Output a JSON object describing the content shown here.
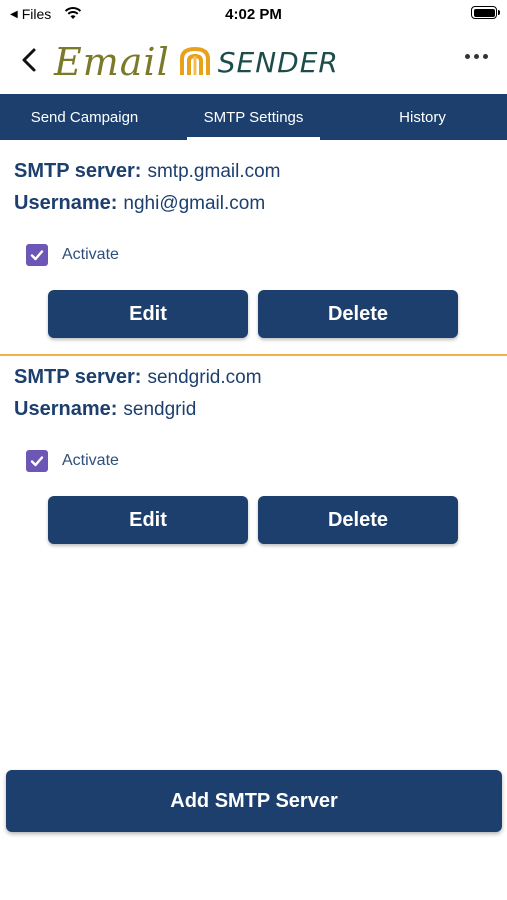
{
  "status_bar": {
    "back_app": "Files",
    "time": "4:02 PM"
  },
  "header": {
    "logo_email": "Email",
    "logo_sender": "SENDER"
  },
  "tabs": [
    {
      "label": "Send Campaign"
    },
    {
      "label": "SMTP Settings",
      "active": true
    },
    {
      "label": "History"
    }
  ],
  "servers": [
    {
      "server_label": "SMTP server:",
      "server": "smtp.gmail.com",
      "username_label": "Username:",
      "username": "nghi@gmail.com",
      "activate_label": "Activate",
      "activated": true,
      "edit_label": "Edit",
      "delete_label": "Delete"
    },
    {
      "server_label": "SMTP server:",
      "server": "sendgrid.com",
      "username_label": "Username:",
      "username": "sendgrid",
      "activate_label": "Activate",
      "activated": true,
      "edit_label": "Edit",
      "delete_label": "Delete"
    }
  ],
  "add_button": "Add SMTP Server",
  "colors": {
    "primary": "#1d3f6e",
    "checkbox": "#6c57b6",
    "divider": "#f1b24a"
  },
  "icons": [
    "back-arrow-icon",
    "more-horizontal-icon",
    "checkmark-icon",
    "wifi-icon",
    "battery-icon"
  ]
}
